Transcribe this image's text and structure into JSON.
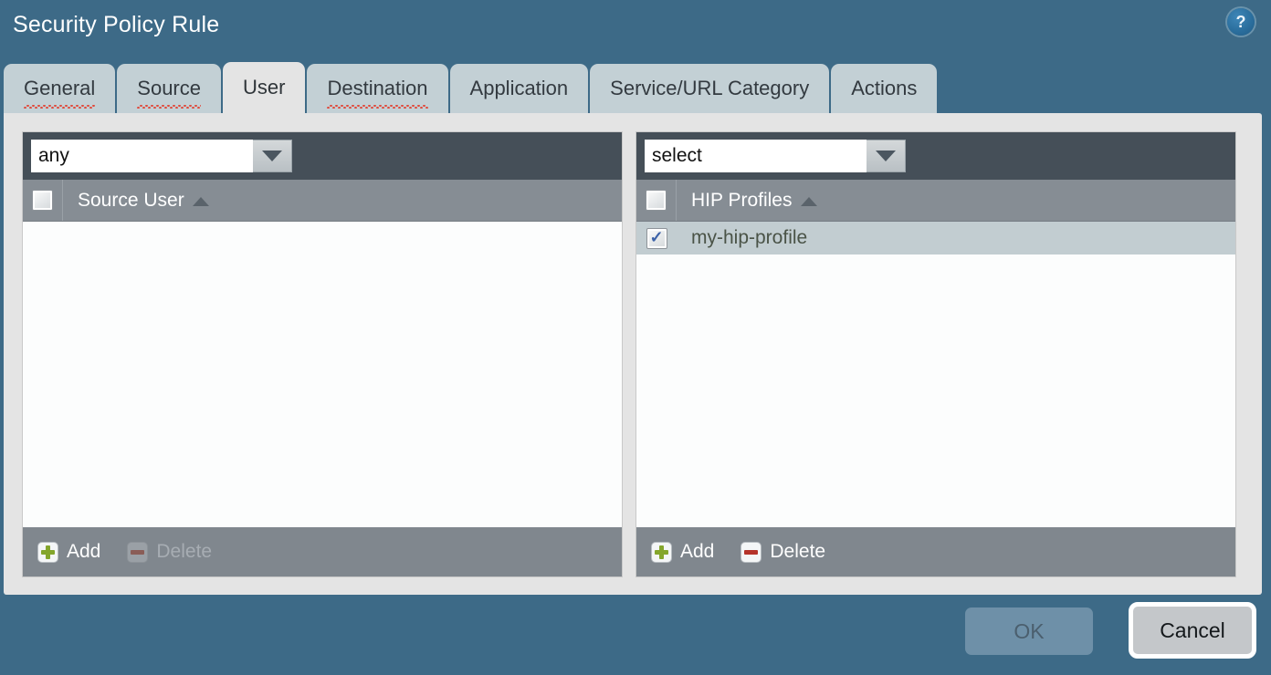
{
  "window": {
    "title": "Security Policy Rule",
    "help_icon": "help-question-icon",
    "help_glyph": "?"
  },
  "tabs": [
    {
      "label": "General",
      "active": false,
      "misspelled": true
    },
    {
      "label": "Source",
      "active": false,
      "misspelled": true
    },
    {
      "label": "User",
      "active": true,
      "misspelled": false
    },
    {
      "label": "Destination",
      "active": false,
      "misspelled": true
    },
    {
      "label": "Application",
      "active": false,
      "misspelled": false
    },
    {
      "label": "Service/URL Category",
      "active": false,
      "misspelled": false
    },
    {
      "label": "Actions",
      "active": false,
      "misspelled": false
    }
  ],
  "source_user_panel": {
    "selector_value": "any",
    "selector_placeholder": "any",
    "dropdown_icon": "chevron-down-icon",
    "header_checkbox_checked": false,
    "column_header": "Source User",
    "sort_direction": "ascending",
    "rows": [],
    "add_label": "Add",
    "delete_label": "Delete",
    "add_enabled": true,
    "delete_enabled": false
  },
  "hip_profiles_panel": {
    "selector_value": "select",
    "selector_placeholder": "select",
    "dropdown_icon": "chevron-down-icon",
    "header_checkbox_checked": false,
    "column_header": "HIP Profiles",
    "sort_direction": "ascending",
    "rows": [
      {
        "label": "my-hip-profile",
        "checked": true,
        "selected": true
      }
    ],
    "add_label": "Add",
    "delete_label": "Delete",
    "add_enabled": true,
    "delete_enabled": true
  },
  "footer": {
    "ok_label": "OK",
    "ok_enabled": false,
    "cancel_label": "Cancel",
    "cancel_enabled": true
  },
  "colors": {
    "dialog_background": "#3d6a87",
    "content_background": "#e4e4e4",
    "tab_inactive": "#c3d0d5",
    "tab_active": "#e4e4e4",
    "panel_selector_bar": "#454f58",
    "table_header": "#868d94",
    "table_body": "#fcfdfd",
    "row_selected": "#c2cdd1",
    "panel_footer": "#80878e",
    "add_icon": "#84a62c",
    "delete_icon": "#b5332a",
    "check_mark": "#3c62a8",
    "spellcheck_underline": "#e04a3c"
  }
}
